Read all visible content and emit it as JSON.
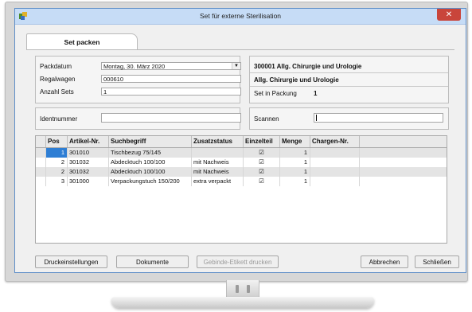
{
  "window": {
    "title": "Set für externe Sterilisation",
    "close_glyph": "✕"
  },
  "tab": {
    "label": "Set packen"
  },
  "form": {
    "packdatum_label": "Packdatum",
    "packdatum_value": "Montag, 30. März 2020",
    "regalwagen_label": "Regalwagen",
    "regalwagen_value": "000610",
    "anzahl_label": "Anzahl Sets",
    "anzahl_value": "1",
    "identnummer_label": "Identnummer",
    "identnummer_value": ""
  },
  "set_info": {
    "code_title": "300001   Allg. Chirurgie und Urologie",
    "subtitle": "Allg. Chirurgie und Urologie",
    "in_packung_label": "Set in Packung",
    "in_packung_value": "1",
    "scannen_label": "Scannen",
    "scannen_value": ""
  },
  "table": {
    "headers": [
      "Pos",
      "Artikel-Nr.",
      "Suchbegriff",
      "Zusatzstatus",
      "Einzelteil",
      "Menge",
      "Chargen-Nr."
    ],
    "rows": [
      {
        "pos": "1",
        "artikel": "301010",
        "such": "Tischbezug 75/145",
        "zusatz": "",
        "einzelteil": "☑",
        "menge": "1",
        "charge": ""
      },
      {
        "pos": "2",
        "artikel": "301032",
        "such": "Abdecktuch 100/100",
        "zusatz": "mit Nachweis",
        "einzelteil": "☑",
        "menge": "1",
        "charge": ""
      },
      {
        "pos": "2",
        "artikel": "301032",
        "such": "Abdecktuch 100/100",
        "zusatz": "mit Nachweis",
        "einzelteil": "☑",
        "menge": "1",
        "charge": ""
      },
      {
        "pos": "3",
        "artikel": "301000",
        "such": "Verpackungstuch 150/200",
        "zusatz": "extra verpackt",
        "einzelteil": "☑",
        "menge": "1",
        "charge": ""
      }
    ]
  },
  "buttons": {
    "druckeinstellungen": "Druckeinstellungen",
    "dokumente": "Dokumente",
    "gebinde": "Gebinde-Etikett drucken",
    "abbrechen": "Abbrechen",
    "schliessen": "Schließen"
  },
  "icons": {
    "app": "app-icon",
    "dropdown": "chevron-down-icon",
    "close": "close-icon"
  },
  "colors": {
    "titlebar": "#c6dcf6",
    "close": "#c9453b",
    "selection": "#2e7ed4",
    "row_shade": "#e4e4e4"
  }
}
